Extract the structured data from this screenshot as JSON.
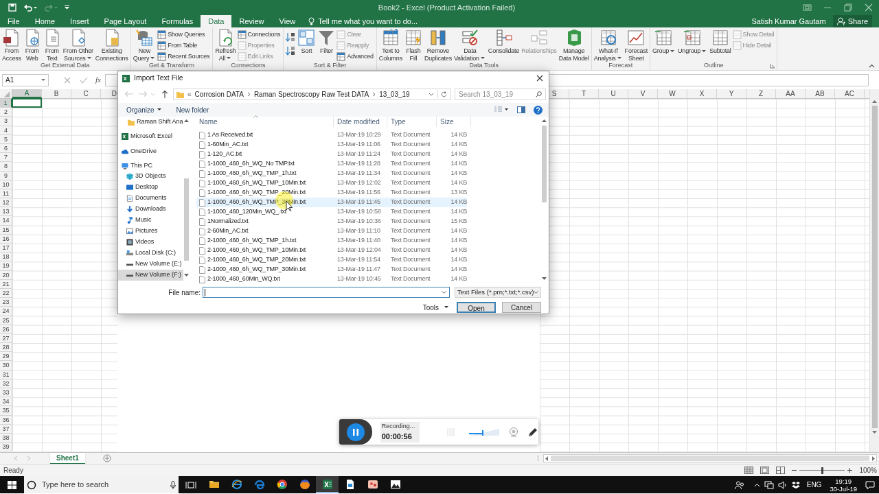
{
  "title_bar": {
    "title": "Book2 - Excel (Product Activation Failed)"
  },
  "ribbon_tabs": [
    {
      "label": "File",
      "selected": false
    },
    {
      "label": "Home",
      "selected": false
    },
    {
      "label": "Insert",
      "selected": false
    },
    {
      "label": "Page Layout",
      "selected": false
    },
    {
      "label": "Formulas",
      "selected": false
    },
    {
      "label": "Data",
      "selected": true
    },
    {
      "label": "Review",
      "selected": false
    },
    {
      "label": "View",
      "selected": false
    }
  ],
  "tell_me": "Tell me what you want to do...",
  "user": {
    "name": "Satish Kumar Gautam",
    "share": "Share"
  },
  "ribbon_groups": [
    {
      "label": "Get External Data",
      "items": [
        {
          "kind": "large",
          "label": "From\nAccess",
          "disabled": false
        },
        {
          "kind": "large",
          "label": "From\nWeb",
          "disabled": false
        },
        {
          "kind": "large",
          "label": "From\nText",
          "disabled": false
        },
        {
          "kind": "large",
          "label": "From Other\nSources",
          "disabled": false,
          "dropdown": true
        },
        {
          "kind": "large",
          "label": "Existing\nConnections",
          "disabled": false
        }
      ]
    },
    {
      "label": "Get & Transform",
      "items": [
        {
          "kind": "large",
          "label": "New\nQuery",
          "disabled": false,
          "dropdown": true
        },
        {
          "kind": "stack",
          "items": [
            {
              "label": "Show Queries",
              "disabled": false
            },
            {
              "label": "From Table",
              "disabled": false
            },
            {
              "label": "Recent Sources",
              "disabled": false
            }
          ]
        }
      ]
    },
    {
      "label": "Connections",
      "items": [
        {
          "kind": "large",
          "label": "Refresh\nAll",
          "disabled": false,
          "dropdown": true
        },
        {
          "kind": "stack",
          "items": [
            {
              "label": "Connections",
              "disabled": false
            },
            {
              "label": "Properties",
              "disabled": true
            },
            {
              "label": "Edit Links",
              "disabled": true
            }
          ]
        }
      ]
    },
    {
      "label": "Sort & Filter",
      "items": [
        {
          "kind": "sort_buttons"
        },
        {
          "kind": "large",
          "label": "Sort",
          "disabled": false
        },
        {
          "kind": "large",
          "label": "Filter",
          "disabled": false
        },
        {
          "kind": "stack",
          "items": [
            {
              "label": "Clear",
              "disabled": true
            },
            {
              "label": "Reapply",
              "disabled": true
            },
            {
              "label": "Advanced",
              "disabled": false
            }
          ]
        }
      ]
    },
    {
      "label": "Data Tools",
      "items": [
        {
          "kind": "large",
          "label": "Text to\nColumns",
          "disabled": false
        },
        {
          "kind": "large",
          "label": "Flash\nFill",
          "disabled": false
        },
        {
          "kind": "large",
          "label": "Remove\nDuplicates",
          "disabled": false
        },
        {
          "kind": "large",
          "label": "Data\nValidation",
          "disabled": false,
          "dropdown": true
        },
        {
          "kind": "large",
          "label": "Consolidate",
          "disabled": false
        },
        {
          "kind": "large",
          "label": "Relationships",
          "disabled": true
        },
        {
          "kind": "large",
          "label": "Manage\nData Model",
          "disabled": false
        }
      ]
    },
    {
      "label": "Forecast",
      "items": [
        {
          "kind": "large",
          "label": "What-If\nAnalysis",
          "disabled": false,
          "dropdown": true
        },
        {
          "kind": "large",
          "label": "Forecast\nSheet",
          "disabled": false
        }
      ]
    },
    {
      "label": "Outline",
      "launcher": true,
      "items": [
        {
          "kind": "large",
          "label": "Group",
          "disabled": false,
          "dropdown": true
        },
        {
          "kind": "large",
          "label": "Ungroup",
          "disabled": false,
          "dropdown": true
        },
        {
          "kind": "large",
          "label": "Subtotal",
          "disabled": false
        },
        {
          "kind": "stack",
          "items": [
            {
              "label": "Show Detail",
              "disabled": true
            },
            {
              "label": "Hide Detail",
              "disabled": true
            }
          ]
        }
      ]
    }
  ],
  "formula_bar": {
    "name_box": "A1",
    "fx": "fx"
  },
  "sheet": {
    "columns": [
      {
        "label": "A",
        "selected": true
      },
      {
        "label": "B",
        "selected": false
      },
      {
        "label": "C",
        "selected": false
      },
      {
        "label": "D",
        "selected": false
      },
      {
        "label": "S",
        "selected": false
      },
      {
        "label": "T",
        "selected": false
      },
      {
        "label": "U",
        "selected": false
      },
      {
        "label": "V",
        "selected": false
      },
      {
        "label": "W",
        "selected": false
      },
      {
        "label": "X",
        "selected": false
      },
      {
        "label": "Y",
        "selected": false
      },
      {
        "label": "Z",
        "selected": false
      },
      {
        "label": "AA",
        "selected": false
      },
      {
        "label": "AB",
        "selected": false
      },
      {
        "label": "AC",
        "selected": false
      }
    ],
    "rows": [
      {
        "label": "1",
        "selected": true
      },
      {
        "label": "2",
        "selected": false
      },
      {
        "label": "3",
        "selected": false
      },
      {
        "label": "4",
        "selected": false
      },
      {
        "label": "5",
        "selected": false
      },
      {
        "label": "6",
        "selected": false
      },
      {
        "label": "7",
        "selected": false
      },
      {
        "label": "8",
        "selected": false
      },
      {
        "label": "9",
        "selected": false
      },
      {
        "label": "10",
        "selected": false
      },
      {
        "label": "11",
        "selected": false
      },
      {
        "label": "12",
        "selected": false
      },
      {
        "label": "13",
        "selected": false
      },
      {
        "label": "14",
        "selected": false
      },
      {
        "label": "15",
        "selected": false
      },
      {
        "label": "16",
        "selected": false
      },
      {
        "label": "17",
        "selected": false
      },
      {
        "label": "18",
        "selected": false
      },
      {
        "label": "19",
        "selected": false
      },
      {
        "label": "20",
        "selected": false
      },
      {
        "label": "21",
        "selected": false
      },
      {
        "label": "22",
        "selected": false
      },
      {
        "label": "23",
        "selected": false
      },
      {
        "label": "24",
        "selected": false
      },
      {
        "label": "25",
        "selected": false
      },
      {
        "label": "26",
        "selected": false
      },
      {
        "label": "27",
        "selected": false
      },
      {
        "label": "28",
        "selected": false
      },
      {
        "label": "29",
        "selected": false
      },
      {
        "label": "30",
        "selected": false
      },
      {
        "label": "31",
        "selected": false
      },
      {
        "label": "32",
        "selected": false
      },
      {
        "label": "33",
        "selected": false
      },
      {
        "label": "34",
        "selected": false
      },
      {
        "label": "35",
        "selected": false
      },
      {
        "label": "36",
        "selected": false
      },
      {
        "label": "37",
        "selected": false
      },
      {
        "label": "38",
        "selected": false
      },
      {
        "label": "39",
        "selected": false
      }
    ]
  },
  "sheet_tabs": [
    {
      "label": "Sheet1",
      "selected": true
    }
  ],
  "status_bar": {
    "text": "Ready",
    "zoom": "100%",
    "zoom_slider": {
      "level": 0.5
    }
  },
  "dialog": {
    "title": "Import Text File",
    "breadcrumb_overflow": "«",
    "breadcrumb": [
      "Corrosion DATA",
      "Raman Spectroscopy Raw Test DATA",
      "13_03_19"
    ],
    "search": {
      "placeholder": "Search 13_03_19"
    },
    "toolbar": [
      "Organize",
      "New folder"
    ],
    "nav": [
      {
        "label": "Raman Shift Ana",
        "selected": false
      },
      {
        "label": "Microsoft Excel",
        "selected": false
      },
      {
        "label": "OneDrive",
        "selected": false
      },
      {
        "label": "This PC",
        "selected": false,
        "children": [
          {
            "label": "3D Objects",
            "selected": false
          },
          {
            "label": "Desktop",
            "selected": false
          },
          {
            "label": "Documents",
            "selected": false
          },
          {
            "label": "Downloads",
            "selected": false
          },
          {
            "label": "Music",
            "selected": false
          },
          {
            "label": "Pictures",
            "selected": false
          },
          {
            "label": "Videos",
            "selected": false
          },
          {
            "label": "Local Disk (C:)",
            "selected": false
          },
          {
            "label": "New Volume (E:)",
            "selected": false
          },
          {
            "label": "New Volume (F:)",
            "selected": true
          }
        ]
      }
    ],
    "columns": [
      "Name",
      "Date modified",
      "Type",
      "Size"
    ],
    "files": [
      {
        "name": "1 As Received.txt",
        "date": "13-Mar-19 10:29",
        "type": "Text Document",
        "size": "14 KB",
        "selected": false
      },
      {
        "name": "1-60Min_AC.txt",
        "date": "13-Mar-19 11:06",
        "type": "Text Document",
        "size": "14 KB",
        "selected": false
      },
      {
        "name": "1-120_AC.txt",
        "date": "13-Mar-19 11:24",
        "type": "Text Document",
        "size": "14 KB",
        "selected": false
      },
      {
        "name": "1-1000_460_6h_WQ_No TMP.txt",
        "date": "13-Mar-19 11:28",
        "type": "Text Document",
        "size": "14 KB",
        "selected": false
      },
      {
        "name": "1-1000_460_6h_WQ_TMP_1h.txt",
        "date": "13-Mar-19 11:34",
        "type": "Text Document",
        "size": "14 KB",
        "selected": false
      },
      {
        "name": "1-1000_460_6h_WQ_TMP_10Min.txt",
        "date": "13-Mar-19 12:02",
        "type": "Text Document",
        "size": "14 KB",
        "selected": false
      },
      {
        "name": "1-1000_460_6h_WQ_TMP_20Min.txt",
        "date": "13-Mar-19 11:56",
        "type": "Text Document",
        "size": "13 KB",
        "selected": false
      },
      {
        "name": "1-1000_460_6h_WQ_TMP_30Min.txt",
        "date": "13-Mar-19 11:45",
        "type": "Text Document",
        "size": "14 KB",
        "selected": true
      },
      {
        "name": "1-1000_460_120Min_WQ_.txt",
        "date": "13-Mar-19 10:58",
        "type": "Text Document",
        "size": "14 KB",
        "selected": false
      },
      {
        "name": "1Normalized.txt",
        "date": "13-Mar-19 10:36",
        "type": "Text Document",
        "size": "15 KB",
        "selected": false
      },
      {
        "name": "2-60Min_AC.txt",
        "date": "13-Mar-19 11:10",
        "type": "Text Document",
        "size": "14 KB",
        "selected": false
      },
      {
        "name": "2-1000_460_6h_WQ_TMP_1h.txt",
        "date": "13-Mar-19 11:40",
        "type": "Text Document",
        "size": "14 KB",
        "selected": false
      },
      {
        "name": "2-1000_460_6h_WQ_TMP_10Min.txt",
        "date": "13-Mar-19 12:04",
        "type": "Text Document",
        "size": "14 KB",
        "selected": false
      },
      {
        "name": "2-1000_460_6h_WQ_TMP_20Min.txt",
        "date": "13-Mar-19 11:54",
        "type": "Text Document",
        "size": "14 KB",
        "selected": false
      },
      {
        "name": "2-1000_460_6h_WQ_TMP_30Min.txt",
        "date": "13-Mar-19 11:47",
        "type": "Text Document",
        "size": "14 KB",
        "selected": false
      },
      {
        "name": "2-1000_460_60Min_WQ.txt",
        "date": "13-Mar-19 10:45",
        "type": "Text Document",
        "size": "14 KB",
        "selected": false
      }
    ],
    "file_name_label": "File name:",
    "file_type": "Text Files (*.prn;*.txt;*.csv)",
    "tools": "Tools",
    "buttons": [
      "Open",
      "Cancel"
    ]
  },
  "recorder": {
    "status": "Recording...",
    "time": "00:00:56",
    "volume": {
      "level": 0.45
    }
  },
  "taskbar": {
    "search": {
      "placeholder": "Type here to search"
    },
    "apps": [
      {
        "selected": false
      },
      {
        "selected": false
      },
      {
        "selected": false
      },
      {
        "selected": false
      },
      {
        "selected": false
      },
      {
        "selected": true
      },
      {
        "selected": false
      },
      {
        "selected": false
      },
      {
        "selected": false
      }
    ],
    "language": "ENG",
    "time": "19:19",
    "date": "30-Jul-19"
  }
}
